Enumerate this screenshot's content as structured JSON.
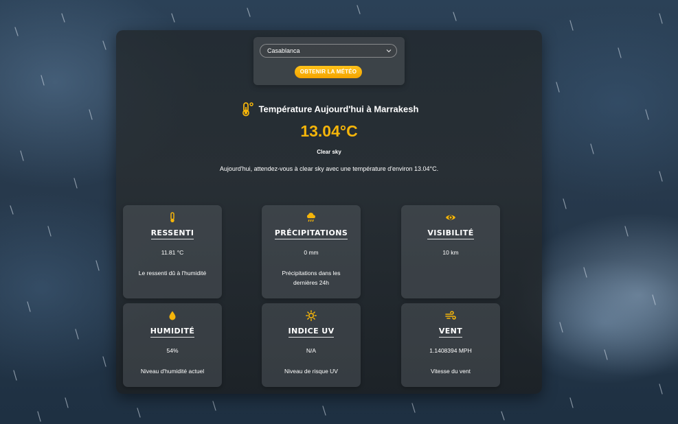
{
  "search": {
    "selected_city": "Casablanca",
    "button_label": "OBTENIR LA MÉTÉO"
  },
  "header": {
    "title": "Température Aujourd'hui à Marrakesh",
    "temperature": "13.04°C",
    "condition": "Clear sky",
    "summary": "Aujourd'hui, attendez-vous à clear sky avec une température d'environ 13.04°C."
  },
  "cards": [
    {
      "icon": "thermometer-icon",
      "label": "RESSENTI",
      "value": "11.81 °C",
      "description": "Le ressenti dû à l'humidité"
    },
    {
      "icon": "cloud-rain-icon",
      "label": "PRÉCIPITATIONS",
      "value": "0 mm",
      "description": "Précipitations dans les dernières 24h"
    },
    {
      "icon": "eye-icon",
      "label": "VISIBILITÉ",
      "value": "10 km",
      "description": ""
    },
    {
      "icon": "droplet-icon",
      "label": "HUMIDITÉ",
      "value": "54%",
      "description": "Niveau d'humidité actuel"
    },
    {
      "icon": "sun-icon",
      "label": "INDICE UV",
      "value": "N/A",
      "description": "Niveau de risque UV"
    },
    {
      "icon": "wind-icon",
      "label": "VENT",
      "value": "1.1408394 MPH",
      "description": "Vitesse du vent"
    }
  ],
  "colors": {
    "accent": "#f5b50a",
    "button": "#f9b40d",
    "panel": "#282c2e"
  }
}
